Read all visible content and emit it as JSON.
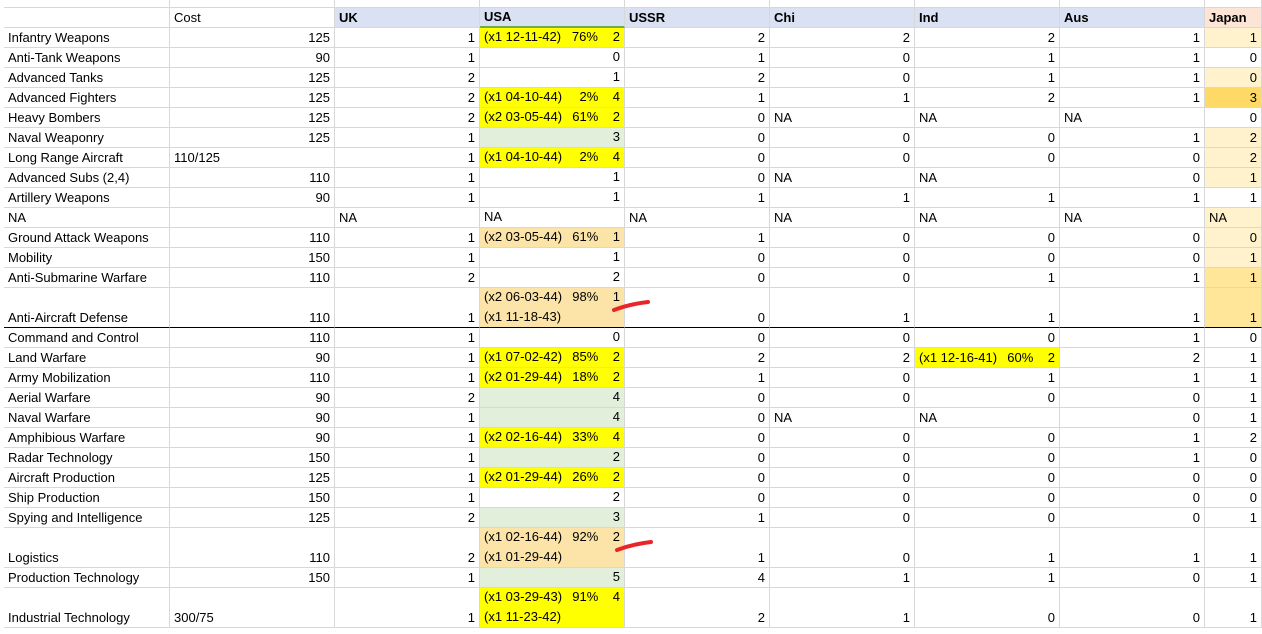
{
  "columns": [
    "",
    "Cost",
    "UK",
    "USA",
    "USSR",
    "Chi",
    "Ind",
    "Aus",
    "Japan"
  ],
  "rows": [
    {
      "name": "Infantry Weapons",
      "cost": "125",
      "uk": "1",
      "usa": [
        {
          "t": "(x1 12-11-42)",
          "p": "76%",
          "v": "2"
        }
      ],
      "ussr": "2",
      "chi": "2",
      "ind": "2",
      "aus": "1",
      "japan": "1",
      "usaBg": "y",
      "japanBg": "jl"
    },
    {
      "name": "Anti-Tank Weapons",
      "cost": "90",
      "uk": "1",
      "usa": [
        {
          "t": "",
          "p": "",
          "v": "0"
        }
      ],
      "ussr": "1",
      "chi": "0",
      "ind": "1",
      "aus": "1",
      "japan": "0",
      "usaBg": "w",
      "japanBg": "w"
    },
    {
      "name": "Advanced Tanks",
      "cost": "125",
      "uk": "2",
      "usa": [
        {
          "t": "",
          "p": "",
          "v": "1"
        }
      ],
      "ussr": "2",
      "chi": "0",
      "ind": "1",
      "aus": "1",
      "japan": "0",
      "usaBg": "w",
      "japanBg": "jl"
    },
    {
      "name": "Advanced Fighters",
      "cost": "125",
      "uk": "2",
      "usa": [
        {
          "t": "(x1 04-10-44)",
          "p": "2%",
          "v": "4"
        }
      ],
      "ussr": "1",
      "chi": "1",
      "ind": "2",
      "aus": "1",
      "japan": "3",
      "usaBg": "y",
      "japanBg": "jd"
    },
    {
      "name": "Heavy Bombers",
      "cost": "125",
      "uk": "2",
      "usa": [
        {
          "t": "(x2 03-05-44)",
          "p": "61%",
          "v": "2"
        }
      ],
      "ussr": "0",
      "chi": "NA",
      "ind": "NA",
      "aus": "NA",
      "japan": "0",
      "usaBg": "y",
      "japanBg": "w",
      "naChi": true
    },
    {
      "name": "Naval Weaponry",
      "cost": "125",
      "uk": "1",
      "usa": [
        {
          "t": "",
          "p": "",
          "v": "3"
        }
      ],
      "ussr": "0",
      "chi": "0",
      "ind": "0",
      "aus": "1",
      "japan": "2",
      "usaBg": "g",
      "japanBg": "jl"
    },
    {
      "name": "Long Range Aircraft",
      "cost": "110/125",
      "uk": "1",
      "usa": [
        {
          "t": "(x1 04-10-44)",
          "p": "2%",
          "v": "4"
        }
      ],
      "ussr": "0",
      "chi": "0",
      "ind": "0",
      "aus": "0",
      "japan": "2",
      "usaBg": "y",
      "japanBg": "jl",
      "costLeft": true
    },
    {
      "name": "Advanced Subs (2,4)",
      "cost": "110",
      "uk": "1",
      "usa": [
        {
          "t": "",
          "p": "",
          "v": "1"
        }
      ],
      "ussr": "0",
      "chi": "NA",
      "ind": "NA",
      "aus": "0",
      "japan": "1",
      "usaBg": "w",
      "japanBg": "jl",
      "naChi": true
    },
    {
      "name": "Artillery Weapons",
      "cost": "90",
      "uk": "1",
      "usa": [
        {
          "t": "",
          "p": "",
          "v": "1"
        }
      ],
      "ussr": "1",
      "chi": "1",
      "ind": "1",
      "aus": "1",
      "japan": "1",
      "usaBg": "w",
      "japanBg": "w"
    },
    {
      "name": "NA",
      "cost": "",
      "uk": "NA",
      "usa": [
        {
          "t": "NA",
          "p": "",
          "v": ""
        }
      ],
      "ussr": "NA",
      "chi": "NA",
      "ind": "NA",
      "aus": "NA",
      "japan": "NA",
      "usaBg": "w",
      "japanBg": "jl",
      "allNA": true
    },
    {
      "name": "Ground Attack Weapons",
      "cost": "110",
      "uk": "1",
      "usa": [
        {
          "t": "(x2 03-05-44)",
          "p": "61%",
          "v": "1"
        }
      ],
      "ussr": "1",
      "chi": "0",
      "ind": "0",
      "aus": "0",
      "japan": "0",
      "usaBg": "o",
      "japanBg": "jl"
    },
    {
      "name": "Mobility",
      "cost": "150",
      "uk": "1",
      "usa": [
        {
          "t": "",
          "p": "",
          "v": "1"
        }
      ],
      "ussr": "0",
      "chi": "0",
      "ind": "0",
      "aus": "0",
      "japan": "1",
      "usaBg": "w",
      "japanBg": "jl"
    },
    {
      "name": "Anti-Submarine Warfare",
      "cost": "110",
      "uk": "2",
      "usa": [
        {
          "t": "",
          "p": "",
          "v": "2"
        }
      ],
      "ussr": "0",
      "chi": "0",
      "ind": "1",
      "aus": "1",
      "japan": "1",
      "usaBg": "w",
      "japanBg": "jm"
    },
    {
      "name": "Anti-Aircraft Defense",
      "cost": "110",
      "uk": "1",
      "usa": [
        {
          "t": "(x2 06-03-44)",
          "p": "98%",
          "v": "1"
        },
        {
          "t": "(x1 11-18-43)",
          "p": "",
          "v": ""
        }
      ],
      "ussr": "0",
      "chi": "1",
      "ind": "1",
      "aus": "1",
      "japan": "1",
      "usaBg": "o",
      "japanBg": "jm",
      "tall": true,
      "thick": true
    },
    {
      "name": "Command and Control",
      "cost": "110",
      "uk": "1",
      "usa": [
        {
          "t": "",
          "p": "",
          "v": "0"
        }
      ],
      "ussr": "0",
      "chi": "0",
      "ind": "0",
      "aus": "1",
      "japan": "0",
      "usaBg": "w",
      "japanBg": "w"
    },
    {
      "name": "Land Warfare",
      "cost": "90",
      "uk": "1",
      "usa": [
        {
          "t": "(x1 07-02-42)",
          "p": "85%",
          "v": "2"
        }
      ],
      "ussr": "2",
      "chi": "2",
      "ind": "(x1 12-16-41)|60%|2",
      "aus": "2",
      "japan": "1",
      "usaBg": "y",
      "japanBg": "w",
      "indY": true
    },
    {
      "name": "Army Mobilization",
      "cost": "110",
      "uk": "1",
      "usa": [
        {
          "t": "(x2 01-29-44)",
          "p": "18%",
          "v": "2"
        }
      ],
      "ussr": "1",
      "chi": "0",
      "ind": "1",
      "aus": "1",
      "japan": "1",
      "usaBg": "y",
      "japanBg": "w"
    },
    {
      "name": "Aerial Warfare",
      "cost": "90",
      "uk": "2",
      "usa": [
        {
          "t": "",
          "p": "",
          "v": "4"
        }
      ],
      "ussr": "0",
      "chi": "0",
      "ind": "0",
      "aus": "0",
      "japan": "1",
      "usaBg": "g",
      "japanBg": "w"
    },
    {
      "name": "Naval Warfare",
      "cost": "90",
      "uk": "1",
      "usa": [
        {
          "t": "",
          "p": "",
          "v": "4"
        }
      ],
      "ussr": "0",
      "chi": "NA",
      "ind": "NA",
      "aus": "0",
      "japan": "1",
      "usaBg": "g",
      "japanBg": "w",
      "naChi": true
    },
    {
      "name": "Amphibious Warfare",
      "cost": "90",
      "uk": "1",
      "usa": [
        {
          "t": "(x2 02-16-44)",
          "p": "33%",
          "v": "4"
        }
      ],
      "ussr": "0",
      "chi": "0",
      "ind": "0",
      "aus": "1",
      "japan": "2",
      "usaBg": "y",
      "japanBg": "w"
    },
    {
      "name": "Radar Technology",
      "cost": "150",
      "uk": "1",
      "usa": [
        {
          "t": "",
          "p": "",
          "v": "2"
        }
      ],
      "ussr": "0",
      "chi": "0",
      "ind": "0",
      "aus": "1",
      "japan": "0",
      "usaBg": "g",
      "japanBg": "w"
    },
    {
      "name": "Aircraft Production",
      "cost": "125",
      "uk": "1",
      "usa": [
        {
          "t": "(x2 01-29-44)",
          "p": "26%",
          "v": "2"
        }
      ],
      "ussr": "0",
      "chi": "0",
      "ind": "0",
      "aus": "0",
      "japan": "0",
      "usaBg": "y",
      "japanBg": "w"
    },
    {
      "name": "Ship Production",
      "cost": "150",
      "uk": "1",
      "usa": [
        {
          "t": "",
          "p": "",
          "v": "2"
        }
      ],
      "ussr": "0",
      "chi": "0",
      "ind": "0",
      "aus": "0",
      "japan": "0",
      "usaBg": "w",
      "japanBg": "w"
    },
    {
      "name": "Spying and Intelligence",
      "cost": "125",
      "uk": "2",
      "usa": [
        {
          "t": "",
          "p": "",
          "v": "3"
        }
      ],
      "ussr": "1",
      "chi": "0",
      "ind": "0",
      "aus": "0",
      "japan": "1",
      "usaBg": "g",
      "japanBg": "w"
    },
    {
      "name": "Logistics",
      "cost": "110",
      "uk": "2",
      "usa": [
        {
          "t": "(x1 02-16-44)",
          "p": "92%",
          "v": "2"
        },
        {
          "t": "(x1 01-29-44)",
          "p": "",
          "v": ""
        }
      ],
      "ussr": "1",
      "chi": "0",
      "ind": "1",
      "aus": "1",
      "japan": "1",
      "usaBg": "o",
      "japanBg": "w",
      "tall": true
    },
    {
      "name": "Production Technology",
      "cost": "150",
      "uk": "1",
      "usa": [
        {
          "t": "",
          "p": "",
          "v": "5"
        }
      ],
      "ussr": "4",
      "chi": "1",
      "ind": "1",
      "aus": "0",
      "japan": "1",
      "usaBg": "g",
      "japanBg": "w"
    },
    {
      "name": "Industrial Technology",
      "cost": "300/75",
      "uk": "1",
      "usa": [
        {
          "t": "(x1 03-29-43)",
          "p": "91%",
          "v": "4"
        },
        {
          "t": "(x1 11-23-42)",
          "p": "",
          "v": ""
        }
      ],
      "ussr": "2",
      "chi": "1",
      "ind": "0",
      "aus": "0",
      "japan": "1",
      "usaBg": "y",
      "japanBg": "w",
      "tall": true,
      "costLeft": true
    }
  ],
  "colors": {
    "header_bg": "#d9e1f2",
    "yellow": "#ffff00",
    "orange_light": "#fce4a8",
    "green_light": "#e2efda",
    "japan_light": "#fff2cc",
    "japan_med": "#ffe699",
    "japan_dark": "#ffd966",
    "annot_red": "#e8262a"
  }
}
